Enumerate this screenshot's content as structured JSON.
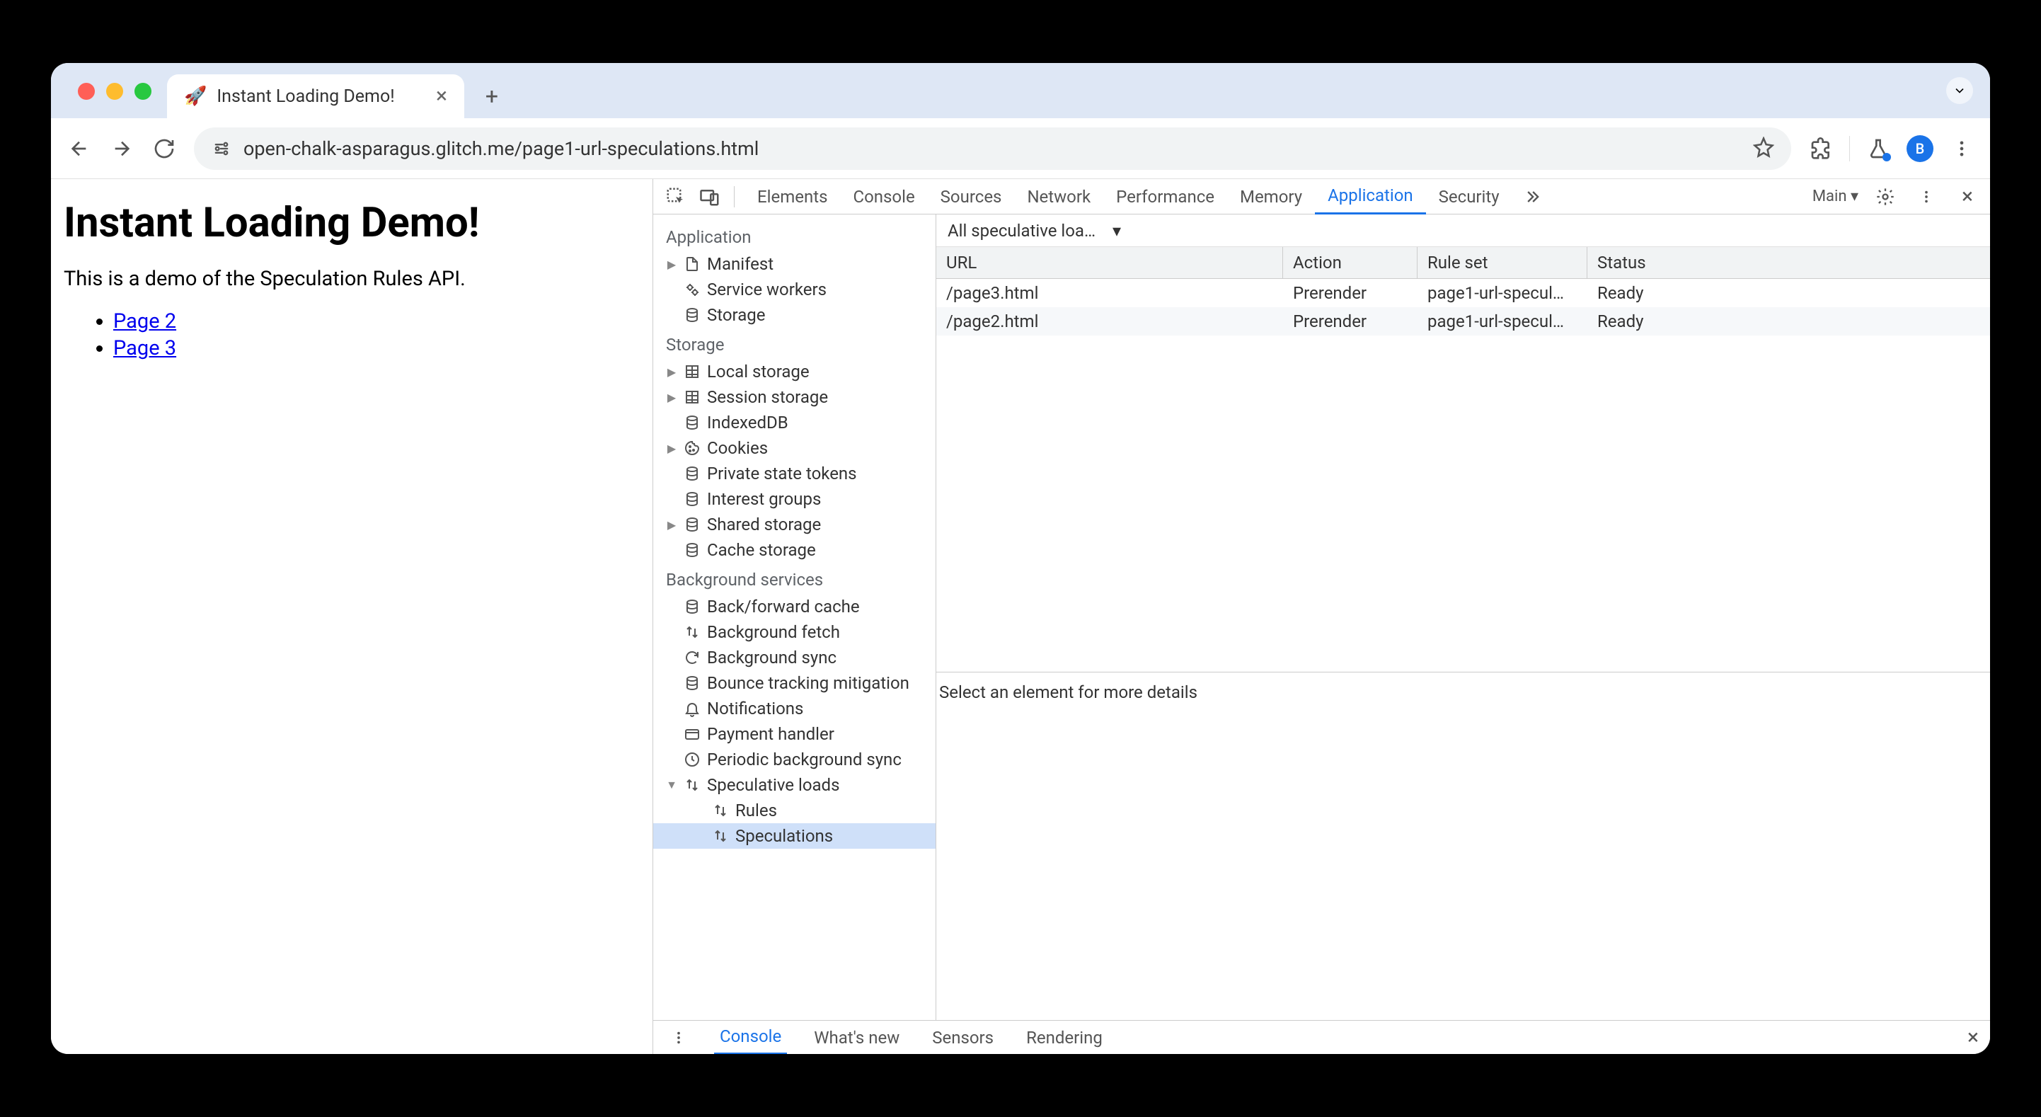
{
  "browser": {
    "tab_title": "Instant Loading Demo!",
    "url": "open-chalk-asparagus.glitch.me/page1-url-speculations.html",
    "avatar_letter": "B",
    "favicon": "🚀"
  },
  "page": {
    "heading": "Instant Loading Demo!",
    "intro": "This is a demo of the Speculation Rules API.",
    "links": [
      "Page 2",
      "Page 3"
    ]
  },
  "devtools": {
    "tabs": [
      "Elements",
      "Console",
      "Sources",
      "Network",
      "Performance",
      "Memory",
      "Application",
      "Security"
    ],
    "active_tab": "Application",
    "target_label": "Main",
    "sidebar": {
      "sections": [
        {
          "title": "Application",
          "items": [
            {
              "label": "Manifest",
              "icon": "file",
              "arrow": true
            },
            {
              "label": "Service workers",
              "icon": "gears"
            },
            {
              "label": "Storage",
              "icon": "db"
            }
          ]
        },
        {
          "title": "Storage",
          "items": [
            {
              "label": "Local storage",
              "icon": "grid",
              "arrow": true
            },
            {
              "label": "Session storage",
              "icon": "grid",
              "arrow": true
            },
            {
              "label": "IndexedDB",
              "icon": "db"
            },
            {
              "label": "Cookies",
              "icon": "cookie",
              "arrow": true
            },
            {
              "label": "Private state tokens",
              "icon": "db"
            },
            {
              "label": "Interest groups",
              "icon": "db"
            },
            {
              "label": "Shared storage",
              "icon": "db",
              "arrow": true
            },
            {
              "label": "Cache storage",
              "icon": "db"
            }
          ]
        },
        {
          "title": "Background services",
          "items": [
            {
              "label": "Back/forward cache",
              "icon": "db"
            },
            {
              "label": "Background fetch",
              "icon": "updown"
            },
            {
              "label": "Background sync",
              "icon": "sync"
            },
            {
              "label": "Bounce tracking mitigation",
              "icon": "db"
            },
            {
              "label": "Notifications",
              "icon": "bell"
            },
            {
              "label": "Payment handler",
              "icon": "card"
            },
            {
              "label": "Periodic background sync",
              "icon": "clock"
            },
            {
              "label": "Speculative loads",
              "icon": "updown",
              "arrow": true,
              "expanded": true,
              "children": [
                {
                  "label": "Rules",
                  "icon": "updown"
                },
                {
                  "label": "Speculations",
                  "icon": "updown",
                  "selected": true
                }
              ]
            }
          ]
        }
      ]
    },
    "filter_label": "All speculative loa…",
    "table": {
      "headers": [
        "URL",
        "Action",
        "Rule set",
        "Status"
      ],
      "rows": [
        {
          "url": "/page3.html",
          "action": "Prerender",
          "ruleset": "page1-url-specul…",
          "status": "Ready"
        },
        {
          "url": "/page2.html",
          "action": "Prerender",
          "ruleset": "page1-url-specul…",
          "status": "Ready"
        }
      ]
    },
    "detail_hint": "Select an element for more details",
    "drawer_tabs": [
      "Console",
      "What's new",
      "Sensors",
      "Rendering"
    ],
    "drawer_active": "Console"
  }
}
